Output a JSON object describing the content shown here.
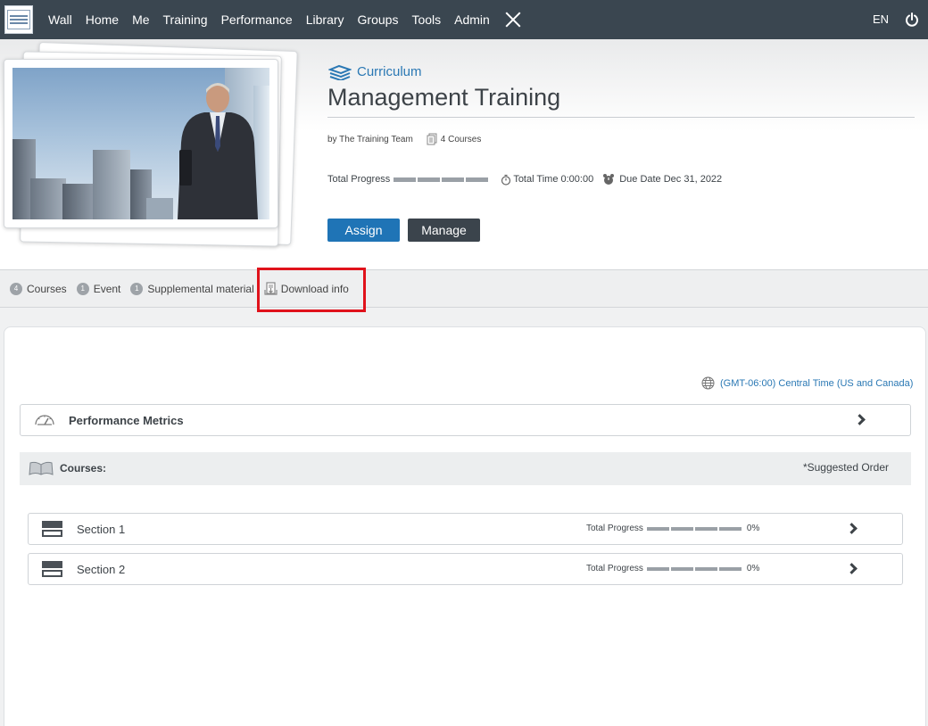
{
  "nav": {
    "items": [
      "Wall",
      "Home",
      "Me",
      "Training",
      "Performance",
      "Library",
      "Groups",
      "Tools",
      "Admin"
    ],
    "language": "EN",
    "icons": {
      "close": "close-x-icon",
      "power": "power-icon",
      "logo": "org-logo-icon"
    }
  },
  "header": {
    "category": "Curriculum",
    "title": "Management Training",
    "author": "by The Training Team",
    "course_count": "4 Courses",
    "total_progress_label": "Total Progress",
    "total_progress_value": 0,
    "total_time": "Total Time 0:00:00",
    "due_date": "Due Date Dec 31, 2022",
    "assign_label": "Assign",
    "manage_label": "Manage"
  },
  "tabs": [
    {
      "count": "4",
      "label": "Courses"
    },
    {
      "count": "1",
      "label": "Event"
    },
    {
      "count": "1",
      "label": "Supplemental material"
    },
    {
      "count": "",
      "label": "Download info"
    }
  ],
  "main": {
    "timezone": "(GMT-06:00) Central Time (US and Canada)",
    "performance_metrics": "Performance Metrics",
    "courses_heading": "Courses:",
    "suggested_order": "*Suggested Order",
    "sections": [
      {
        "name": "Section 1",
        "progress_label": "Total Progress",
        "progress": "0%"
      },
      {
        "name": "Section 2",
        "progress_label": "Total Progress",
        "progress": "0%"
      }
    ]
  },
  "colors": {
    "nav_bg": "#3a4650",
    "accent": "#1f74b6",
    "manage_btn": "#3b444c",
    "highlight": "#e0121b"
  }
}
